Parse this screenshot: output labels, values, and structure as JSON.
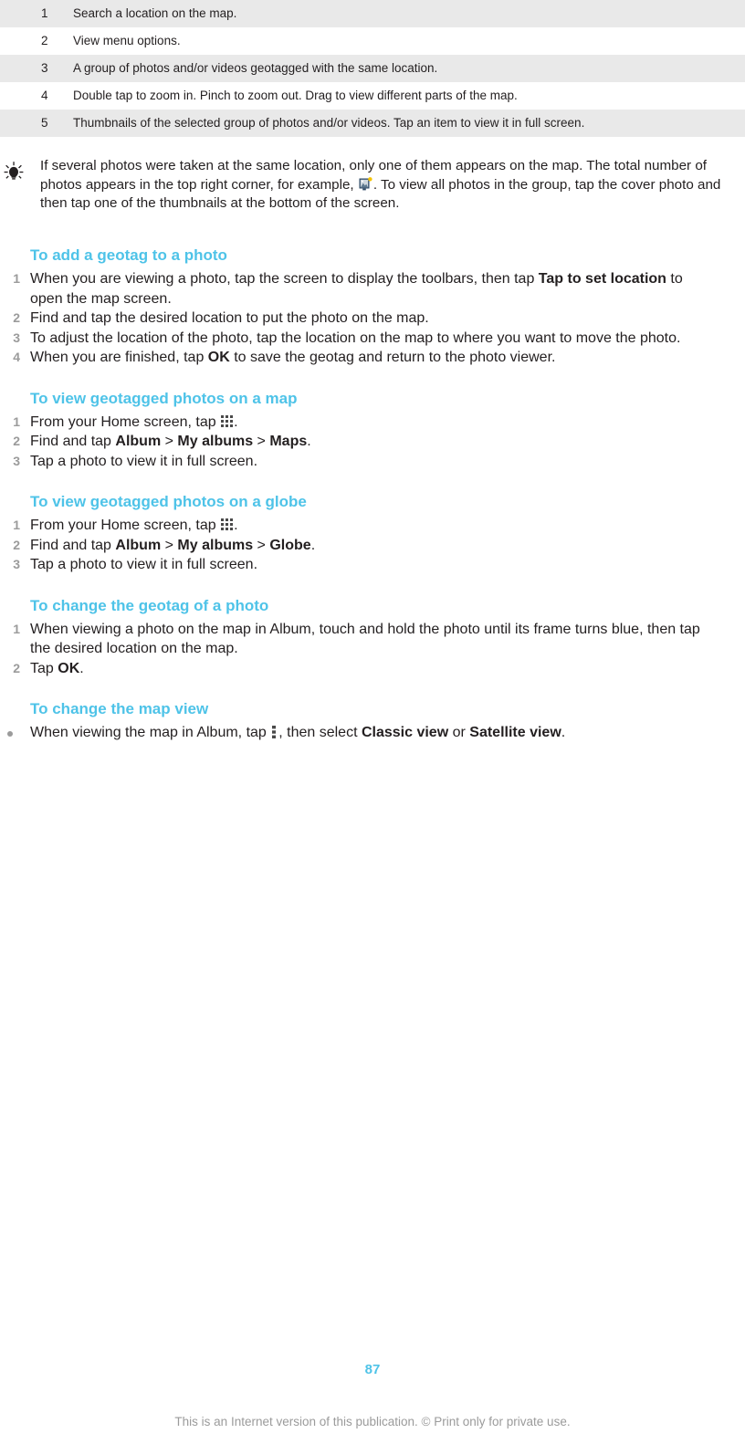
{
  "legend_table": {
    "rows": [
      {
        "num": "1",
        "desc": "Search a location on the map."
      },
      {
        "num": "2",
        "desc": "View menu options."
      },
      {
        "num": "3",
        "desc": "A group of photos and/or videos geotagged with the same location."
      },
      {
        "num": "4",
        "desc": "Double tap to zoom in. Pinch to zoom out. Drag to view different parts of the map."
      },
      {
        "num": "5",
        "desc": "Thumbnails of the selected group of photos and/or videos. Tap an item to view it in full screen."
      }
    ]
  },
  "tip": {
    "icon": "lightbulb-tip-icon",
    "text_part1": "If several photos were taken at the same location, only one of them appears on the map. The total number of photos appears in the top right corner, for example,",
    "inline_icon": "photo-count-badge-icon",
    "text_part2": ". To view all photos in the group, tap the cover photo and then tap one of the thumbnails at the bottom of the screen."
  },
  "sections": [
    {
      "heading": "To add a geotag to a photo",
      "list_type": "ordered",
      "steps": [
        {
          "marker": "1",
          "parts": [
            {
              "t": "When you are viewing a photo, tap the screen to display the toolbars, then tap ",
              "bold": false
            },
            {
              "t": "Tap to set location",
              "bold": true
            },
            {
              "t": " to open the map screen.",
              "bold": false
            }
          ]
        },
        {
          "marker": "2",
          "parts": [
            {
              "t": "Find and tap the desired location to put the photo on the map.",
              "bold": false
            }
          ]
        },
        {
          "marker": "3",
          "parts": [
            {
              "t": "To adjust the location of the photo, tap the location on the map to where you want to move the photo.",
              "bold": false
            }
          ]
        },
        {
          "marker": "4",
          "parts": [
            {
              "t": "When you are finished, tap ",
              "bold": false
            },
            {
              "t": "OK",
              "bold": true
            },
            {
              "t": " to save the geotag and return to the photo viewer.",
              "bold": false
            }
          ]
        }
      ]
    },
    {
      "heading": "To view geotagged photos on a map",
      "list_type": "ordered",
      "steps": [
        {
          "marker": "1",
          "parts": [
            {
              "t": "From your Home screen, tap ",
              "bold": false
            },
            {
              "icon": "app-drawer-grid-icon"
            },
            {
              "t": ".",
              "bold": false
            }
          ]
        },
        {
          "marker": "2",
          "parts": [
            {
              "t": "Find and tap ",
              "bold": false
            },
            {
              "t": "Album",
              "bold": true
            },
            {
              "t": " > ",
              "bold": false
            },
            {
              "t": "My albums",
              "bold": true
            },
            {
              "t": " > ",
              "bold": false
            },
            {
              "t": "Maps",
              "bold": true
            },
            {
              "t": ".",
              "bold": false
            }
          ]
        },
        {
          "marker": "3",
          "parts": [
            {
              "t": "Tap a photo to view it in full screen.",
              "bold": false
            }
          ]
        }
      ]
    },
    {
      "heading": "To view geotagged photos on a globe",
      "list_type": "ordered",
      "steps": [
        {
          "marker": "1",
          "parts": [
            {
              "t": "From your Home screen, tap ",
              "bold": false
            },
            {
              "icon": "app-drawer-grid-icon"
            },
            {
              "t": ".",
              "bold": false
            }
          ]
        },
        {
          "marker": "2",
          "parts": [
            {
              "t": "Find and tap ",
              "bold": false
            },
            {
              "t": "Album",
              "bold": true
            },
            {
              "t": " > ",
              "bold": false
            },
            {
              "t": "My albums",
              "bold": true
            },
            {
              "t": " > ",
              "bold": false
            },
            {
              "t": "Globe",
              "bold": true
            },
            {
              "t": ".",
              "bold": false
            }
          ]
        },
        {
          "marker": "3",
          "parts": [
            {
              "t": "Tap a photo to view it in full screen.",
              "bold": false
            }
          ]
        }
      ]
    },
    {
      "heading": "To change the geotag of a photo",
      "list_type": "ordered",
      "steps": [
        {
          "marker": "1",
          "parts": [
            {
              "t": "When viewing a photo on the map in Album, touch and hold the photo until its frame turns blue, then tap the desired location on the map.",
              "bold": false
            }
          ]
        },
        {
          "marker": "2",
          "parts": [
            {
              "t": "Tap ",
              "bold": false
            },
            {
              "t": "OK",
              "bold": true
            },
            {
              "t": ".",
              "bold": false
            }
          ]
        }
      ]
    },
    {
      "heading": "To change the map view",
      "list_type": "bulleted",
      "steps": [
        {
          "marker": "•",
          "parts": [
            {
              "t": "When viewing the map in Album, tap ",
              "bold": false
            },
            {
              "icon": "overflow-menu-kebab-icon"
            },
            {
              "t": ", then select ",
              "bold": false
            },
            {
              "t": "Classic view",
              "bold": true
            },
            {
              "t": " or ",
              "bold": false
            },
            {
              "t": "Satellite view",
              "bold": true
            },
            {
              "t": ".",
              "bold": false
            }
          ]
        }
      ]
    }
  ],
  "footer": {
    "page_number": "87",
    "note": "This is an Internet version of this publication. © Print only for private use."
  },
  "colors": {
    "heading": "#4ec3e8",
    "page_number": "#4ec3e8",
    "body_text": "#231f20",
    "marker": "#9b9b9b",
    "footer": "#9b9b9b",
    "row_shaded": "#e9e9e9",
    "row_plain": "#ffffff"
  }
}
